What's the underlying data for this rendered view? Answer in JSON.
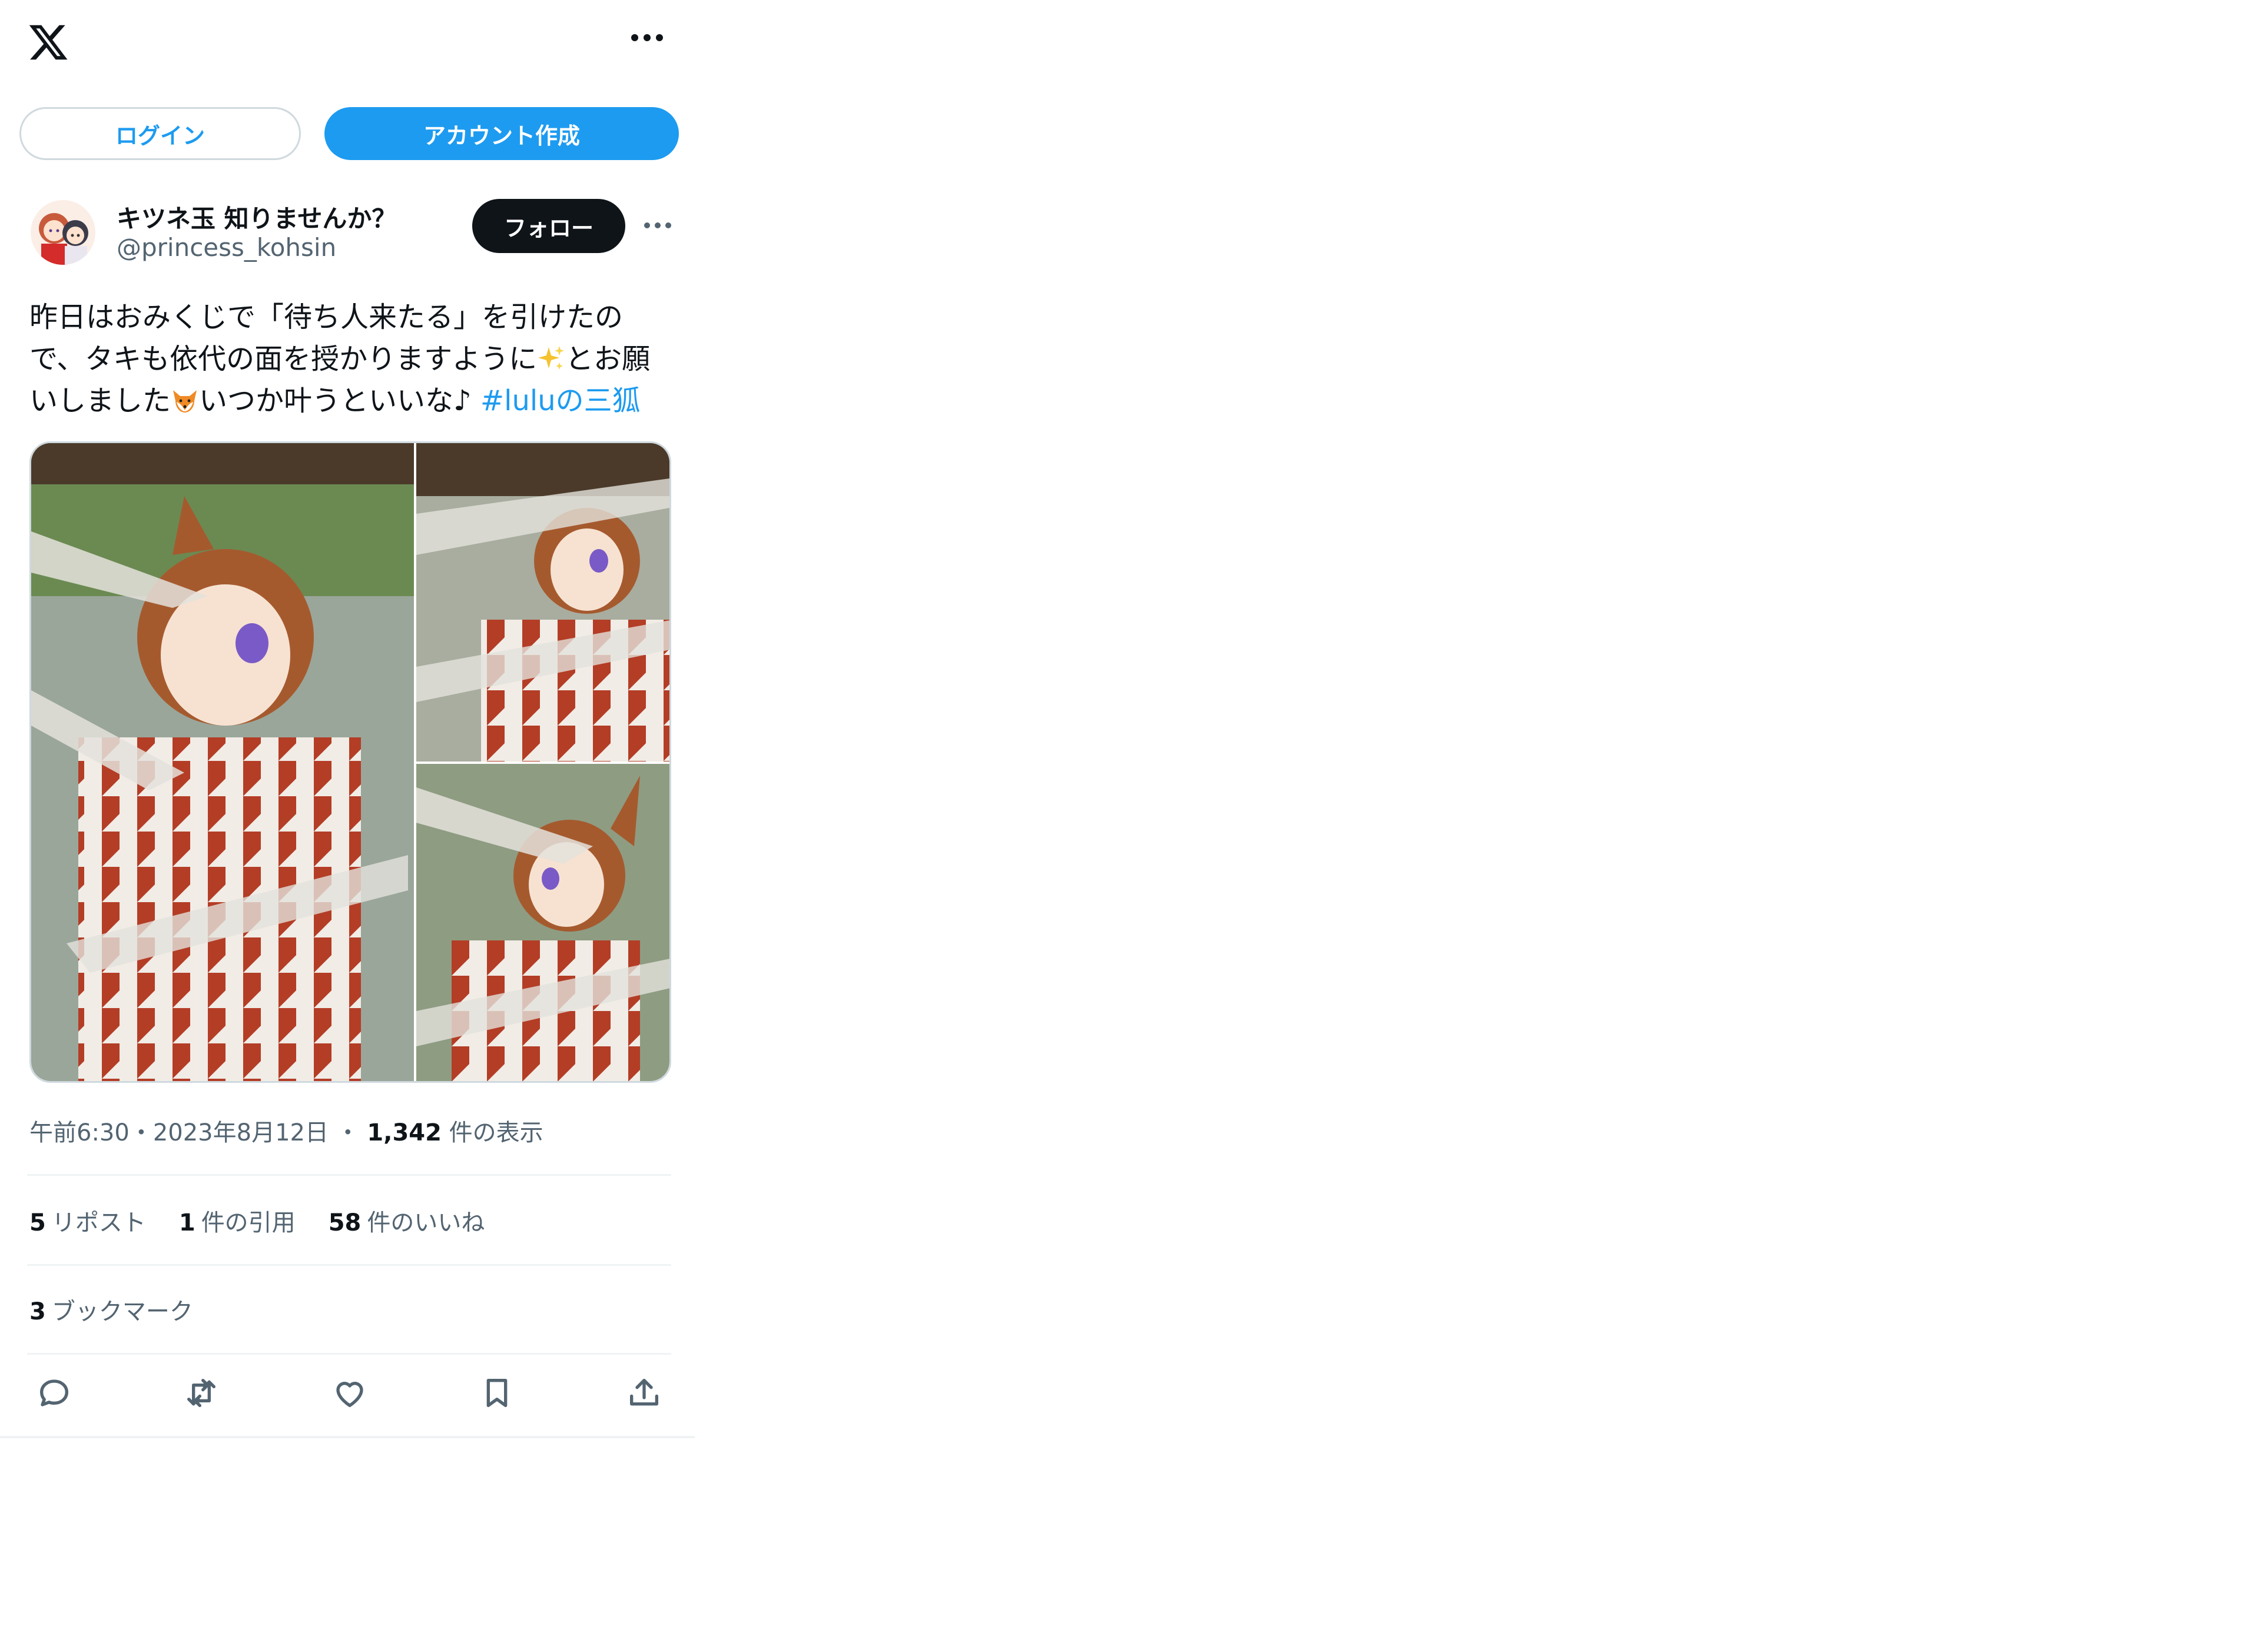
{
  "header": {
    "logo_icon": "x-logo-icon",
    "more_icon": "more-horizontal-icon"
  },
  "auth": {
    "login_label": "ログイン",
    "create_account_label": "アカウント作成"
  },
  "post": {
    "author": {
      "display_name": "キツネ玉 知りませんか？",
      "handle": "@princess_kohsin",
      "follow_label": "フォロー"
    },
    "text": {
      "part1": "昨日はおみくじで「待ち人来たる」を引けたので、タキも依代の面を授かりますように",
      "emoji1": "sparkles-emoji",
      "part2": "とお願いしました",
      "emoji2": "fox-face-emoji",
      "part3": "いつか叶うといいな♪ ",
      "hashtag": "#luluの三狐"
    },
    "media": {
      "photos": [
        {
          "alt": "photo-1"
        },
        {
          "alt": "photo-2"
        },
        {
          "alt": "photo-3"
        }
      ]
    },
    "meta": {
      "time": "午前6:30",
      "separator": "・",
      "date": "2023年8月12日",
      "separator2": "・",
      "views": "1,342",
      "views_label": "件の表示"
    },
    "stats": {
      "reposts": "5",
      "reposts_label": "リポスト",
      "quotes": "1",
      "quotes_label": "件の引用",
      "likes": "58",
      "likes_label": "件のいいね",
      "bookmarks": "3",
      "bookmarks_label": "ブックマーク"
    },
    "actions": [
      "reply-icon",
      "repost-icon",
      "like-icon",
      "bookmark-icon",
      "share-icon"
    ]
  },
  "colors": {
    "accent": "#1d9bf0",
    "text": "#0f1419",
    "secondary": "#536471",
    "border": "#eff3f4"
  }
}
